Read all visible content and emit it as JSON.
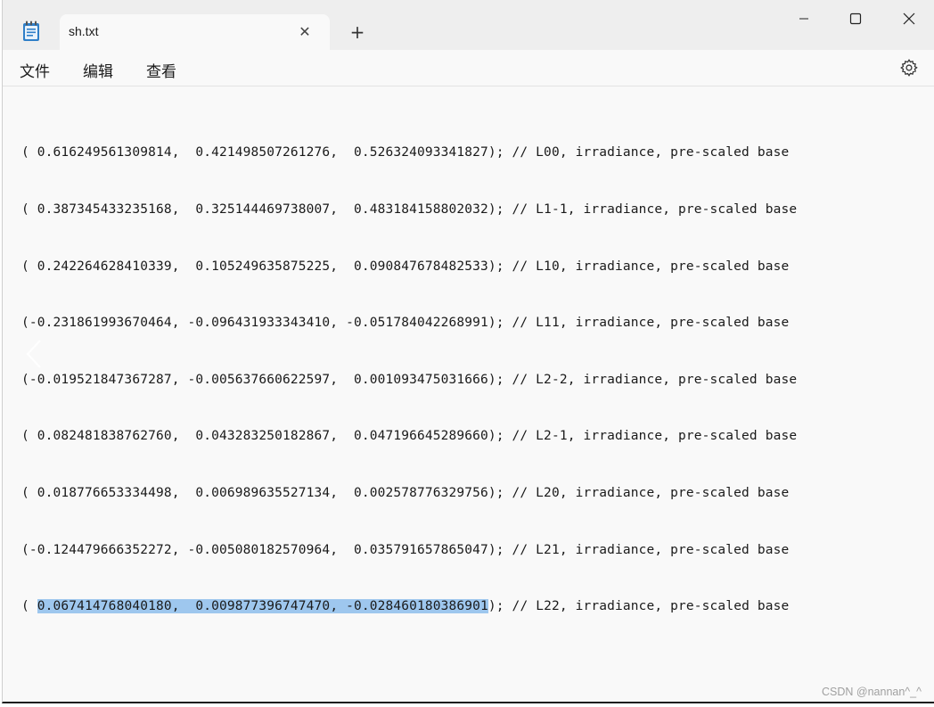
{
  "tab": {
    "title": "sh.txt",
    "close_glyph": "✕",
    "new_tab_glyph": "+"
  },
  "window_controls": {
    "minimize_glyph": "—",
    "maximize_glyph": "☐",
    "close_glyph": "✕"
  },
  "menu": {
    "file": "文件",
    "edit": "编辑",
    "view": "查看"
  },
  "icons": {
    "app": "notepad-icon",
    "settings": "gear-icon",
    "back": "chevron-left-icon"
  },
  "colors": {
    "selection": "#9ec7ee",
    "text": "#1a1a1a",
    "background": "#f9f9f9"
  },
  "lines": [
    {
      "before": "( 0.616249561309814,  0.421498507261276,  0.526324093341827); // L00, irradiance, pre-scaled base",
      "selected": "",
      "after": ""
    },
    {
      "before": "( 0.387345433235168,  0.325144469738007,  0.483184158802032); // L1-1, irradiance, pre-scaled base",
      "selected": "",
      "after": ""
    },
    {
      "before": "( 0.242264628410339,  0.105249635875225,  0.090847678482533); // L10, irradiance, pre-scaled base",
      "selected": "",
      "after": ""
    },
    {
      "before": "(-0.231861993670464, -0.096431933343410, -0.051784042268991); // L11, irradiance, pre-scaled base",
      "selected": "",
      "after": ""
    },
    {
      "before": "(-0.019521847367287, -0.005637660622597,  0.001093475031666); // L2-2, irradiance, pre-scaled base",
      "selected": "",
      "after": ""
    },
    {
      "before": "( 0.082481838762760,  0.043283250182867,  0.047196645289660); // L2-1, irradiance, pre-scaled base",
      "selected": "",
      "after": ""
    },
    {
      "before": "( 0.018776653334498,  0.006989635527134,  0.002578776329756); // L20, irradiance, pre-scaled base",
      "selected": "",
      "after": ""
    },
    {
      "before": "(-0.124479666352272, -0.005080182570964,  0.035791657865047); // L21, irradiance, pre-scaled base",
      "selected": "",
      "after": ""
    },
    {
      "before": "( ",
      "selected": "0.067414768040180,  0.009877396747470, -0.028460180386901",
      "after": "); // L22, irradiance, pre-scaled base"
    }
  ],
  "watermark": "CSDN @nannan^_^"
}
